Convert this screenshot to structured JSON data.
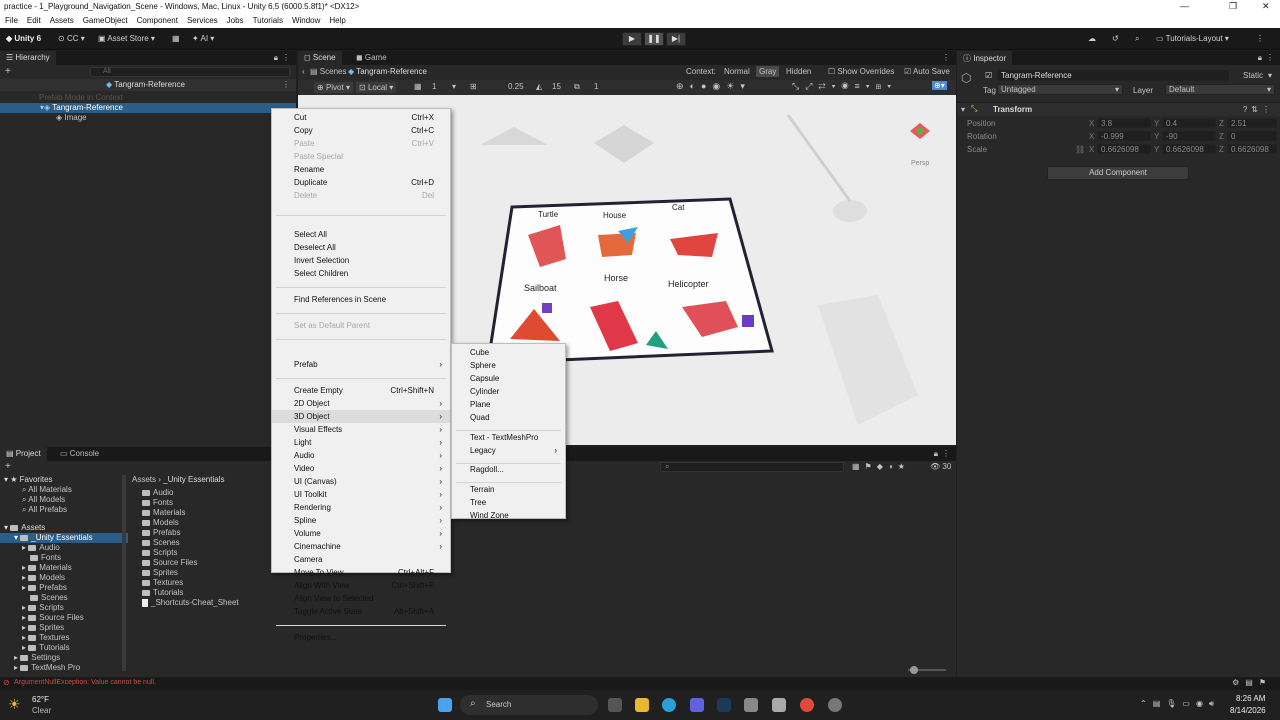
{
  "window": {
    "title": "practice - 1_Playground_Navigation_Scene - Windows, Mac, Linux - Unity 6.5 (6000.5.8f1)* <DX12>",
    "min": "—",
    "max": "❐",
    "close": "✕"
  },
  "menu": [
    "File",
    "Edit",
    "Assets",
    "GameObject",
    "Component",
    "Services",
    "Jobs",
    "Tutorials",
    "Window",
    "Help"
  ],
  "toolbar": {
    "unity": "Unity 6",
    "cc": "CC",
    "asset_store": "Asset Store",
    "ai": "AI",
    "layout": "Tutorials-Layout",
    "play": "▶",
    "pause": "❚❚",
    "step": "▶|"
  },
  "hierarchy": {
    "tab": "Hierarchy",
    "search_placeholder": "All",
    "prefab_title": "Tangram-Reference",
    "prefab_mode": "Prefab Mode in Context",
    "items": [
      "Tangram-Reference",
      "Image"
    ]
  },
  "scene": {
    "tabs": [
      "Scene",
      "Game"
    ],
    "breadcrumb_root": "Scenes",
    "breadcrumb_item": "Tangram-Reference",
    "context_label": "Context:",
    "context_options": [
      "Normal",
      "Gray",
      "Hidden"
    ],
    "show_overrides": "Show Overrides",
    "auto_save": "Auto Save",
    "pivot": "Pivot",
    "local": "Local",
    "grid_val": "1",
    "snap_val": "0.25",
    "angle_val": "15",
    "scale_val": "1",
    "persp": "Persp",
    "board_labels": [
      "Turtle",
      "House",
      "Cat",
      "Sailboat",
      "Horse",
      "Helicopter"
    ]
  },
  "context_menu": {
    "items": [
      {
        "label": "Cut",
        "shortcut": "Ctrl+X"
      },
      {
        "label": "Copy",
        "shortcut": "Ctrl+C"
      },
      {
        "label": "Paste",
        "shortcut": "Ctrl+V",
        "disabled": true
      },
      {
        "label": "Paste Special",
        "shortcut": "",
        "disabled": true
      },
      {
        "label": "Rename",
        "shortcut": ""
      },
      {
        "label": "Duplicate",
        "shortcut": "Ctrl+D"
      },
      {
        "label": "Delete",
        "shortcut": "Del",
        "disabled": true
      },
      {
        "label": "Select All",
        "shortcut": ""
      },
      {
        "label": "Deselect All",
        "shortcut": ""
      },
      {
        "label": "Invert Selection",
        "shortcut": ""
      },
      {
        "label": "Select Children",
        "shortcut": ""
      },
      {
        "label": "Find References in Scene",
        "shortcut": ""
      },
      {
        "label": "Set as Default Parent",
        "shortcut": "",
        "disabled": true
      },
      {
        "label": "Prefab",
        "shortcut": "",
        "submenu": true
      },
      {
        "label": "Create Empty",
        "shortcut": "Ctrl+Shift+N"
      },
      {
        "label": "2D Object",
        "submenu": true
      },
      {
        "label": "3D Object",
        "submenu": true,
        "highlight": true
      },
      {
        "label": "Visual Effects",
        "submenu": true
      },
      {
        "label": "Light",
        "submenu": true
      },
      {
        "label": "Audio",
        "submenu": true
      },
      {
        "label": "Video",
        "submenu": true
      },
      {
        "label": "UI (Canvas)",
        "submenu": true
      },
      {
        "label": "UI Toolkit",
        "submenu": true
      },
      {
        "label": "Rendering",
        "submenu": true
      },
      {
        "label": "Spline",
        "submenu": true
      },
      {
        "label": "Volume",
        "submenu": true
      },
      {
        "label": "Cinemachine",
        "submenu": true
      },
      {
        "label": "Camera"
      },
      {
        "label": "Move To View",
        "shortcut": "Ctrl+Alt+F"
      },
      {
        "label": "Align With View",
        "shortcut": "Ctrl+Shift+F"
      },
      {
        "label": "Align View to Selected"
      },
      {
        "label": "Toggle Active State",
        "shortcut": "Alt+Shift+A"
      },
      {
        "label": "Properties..."
      }
    ]
  },
  "submenu_3d": {
    "items": [
      "Cube",
      "Sphere",
      "Capsule",
      "Cylinder",
      "Plane",
      "Quad",
      "Text - TextMeshPro",
      "Legacy",
      "Ragdoll...",
      "Terrain",
      "Tree",
      "Wind Zone"
    ]
  },
  "inspector": {
    "tab": "Inspector",
    "name": "Tangram-Reference",
    "static": "Static",
    "tag_label": "Tag",
    "tag_value": "Untagged",
    "layer_label": "Layer",
    "layer_value": "Default",
    "component": "Transform",
    "rows": [
      {
        "label": "Position",
        "x": "3.8",
        "y": "0.4",
        "z": "2.51"
      },
      {
        "label": "Rotation",
        "x": "-0.999",
        "y": "-90",
        "z": "0"
      },
      {
        "label": "Scale",
        "x": "0.6626098",
        "y": "0.6626098",
        "z": "0.6626098"
      }
    ],
    "add_component": "Add Component"
  },
  "project": {
    "tabs": [
      "Project",
      "Console"
    ],
    "favorites": [
      "Favorites",
      "All Materials",
      "All Models",
      "All Prefabs"
    ],
    "assets_root": "Assets",
    "tree": [
      "_Unity Essentials",
      "Audio",
      "Fonts",
      "Materials",
      "Models",
      "Prefabs",
      "Scenes",
      "Scripts",
      "Source Files",
      "Sprites",
      "Textures",
      "Tutorials",
      "Settings",
      "TextMesh Pro"
    ],
    "breadcrumb": [
      "Assets",
      "_Unity Essentials"
    ],
    "files": [
      "Audio",
      "Fonts",
      "Materials",
      "Models",
      "Prefabs",
      "Scenes",
      "Scripts",
      "Source Files",
      "Sprites",
      "Textures",
      "Tutorials",
      "_Shortcuts-Cheat_Sheet"
    ],
    "count": "30"
  },
  "status": {
    "error": "ArgumentNullException: Value cannot be null."
  },
  "taskbar": {
    "temp": "62°F",
    "weather": "Clear",
    "search": "Search",
    "time": "8:26 AM",
    "date": "8/14/2026"
  },
  "colors": {
    "selection": "#2c5d87",
    "accent": "#4a8ad6"
  }
}
